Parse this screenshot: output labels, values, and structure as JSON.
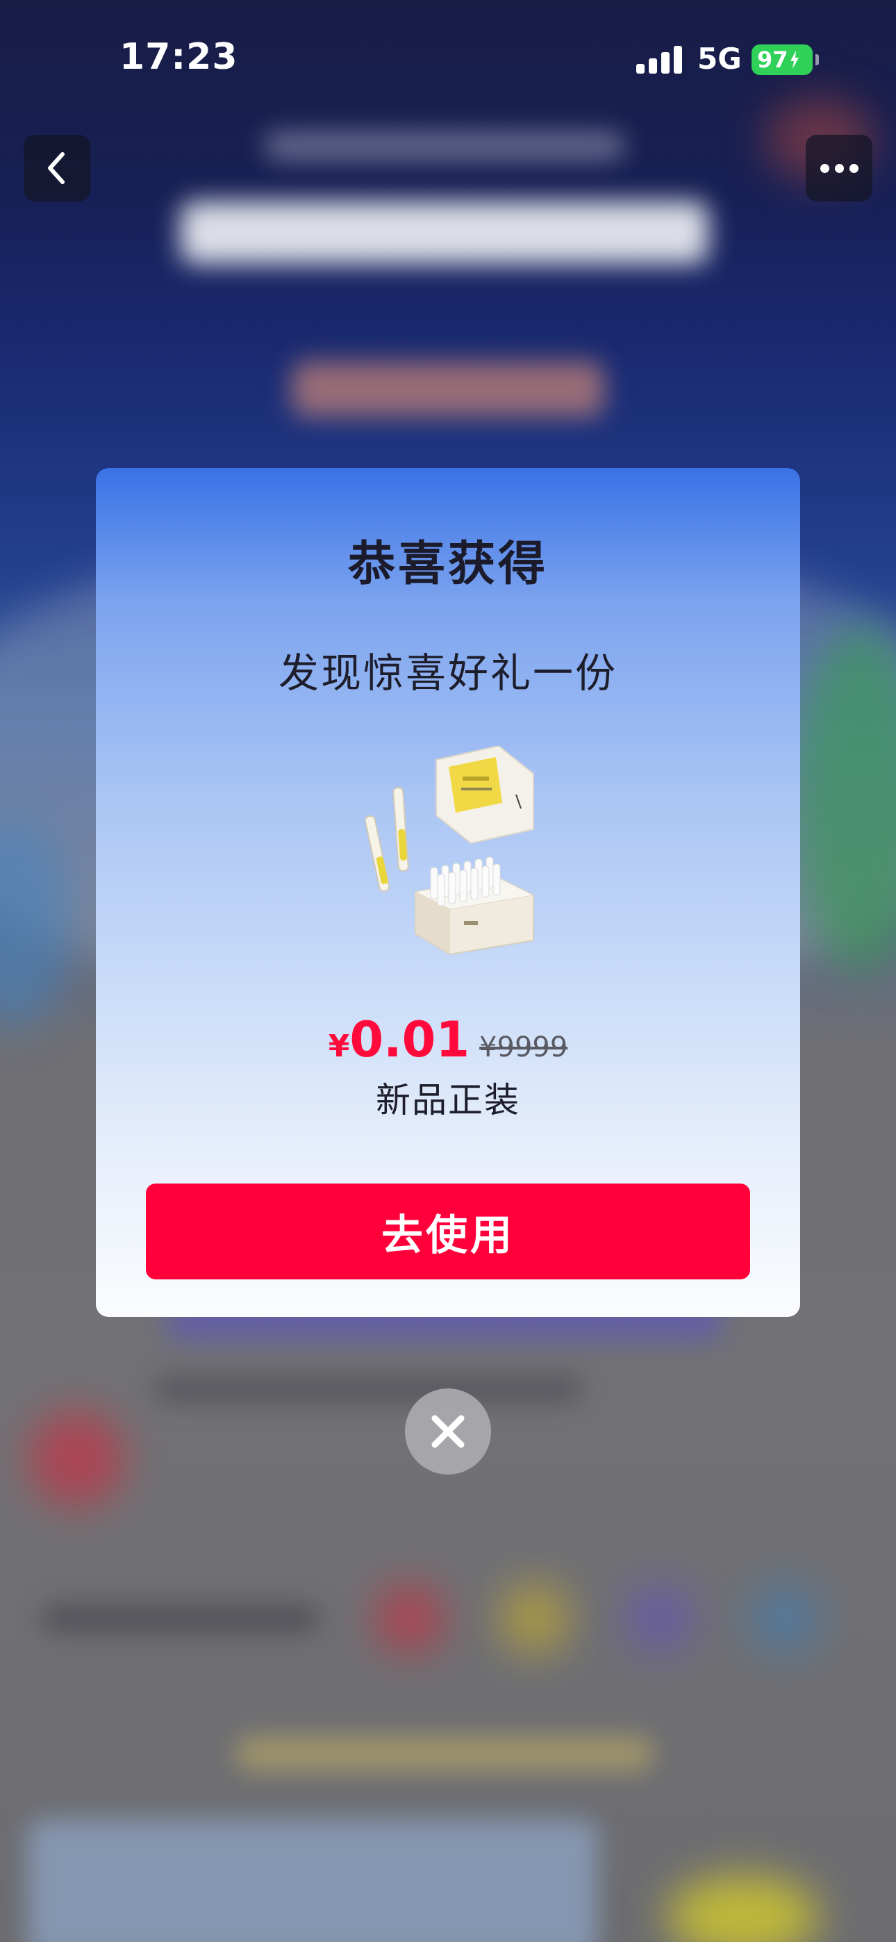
{
  "status_bar": {
    "time": "17:23",
    "network": "5G",
    "battery": "97"
  },
  "nav": {
    "back_icon": "chevron-left-icon",
    "more_icon": "more-horizontal-icon"
  },
  "modal": {
    "title": "恭喜获得",
    "subtitle": "发现惊喜好礼一份",
    "price_symbol": "¥",
    "price": "0.01",
    "original_price": "¥9999",
    "description": "新品正装",
    "button_label": "去使用"
  },
  "colors": {
    "accent": "#ff003a",
    "price": "#ff0a3a",
    "battery": "#30d158"
  }
}
